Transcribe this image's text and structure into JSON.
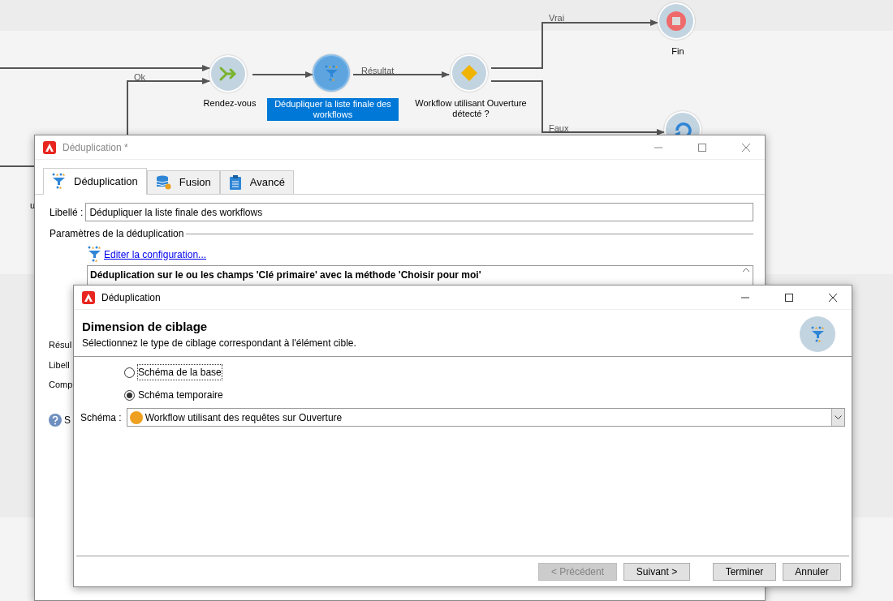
{
  "canvas": {
    "nodes": [
      {
        "kind": "join",
        "label": "Rendez-vous",
        "selected": false
      },
      {
        "kind": "dedup",
        "label": "Dédupliquer la liste finale des workflows",
        "selected": true
      },
      {
        "kind": "test",
        "label": "Workflow utilisant Ouverture détecté ?",
        "selected": false
      },
      {
        "kind": "end",
        "label": "Fin",
        "selected": false
      },
      {
        "kind": "loop",
        "selected": false
      }
    ],
    "edge_labels": [
      "Ok",
      "Résultat",
      "Vrai",
      "Faux"
    ],
    "cut_label": "u"
  },
  "back_window": {
    "title": "Déduplication *",
    "tabs": [
      {
        "kind": "dedup",
        "label": "Déduplication",
        "selected": true
      },
      {
        "kind": "merge",
        "label": "Fusion",
        "selected": false
      },
      {
        "kind": "advanced",
        "label": "Avancé",
        "selected": false
      }
    ],
    "label_field": {
      "label": "Libellé :",
      "value": "Dédupliquer la liste finale des workflows"
    },
    "section_title": "Paramètres de la déduplication",
    "link": "Editer la configuration...",
    "summary": "Déduplication sur le ou les champs 'Clé primaire' avec la méthode 'Choisir pour moi'",
    "cut_labels": [
      "Résul",
      "Libell",
      "Comp"
    ],
    "help_text": "S"
  },
  "front_window": {
    "title": "Déduplication",
    "heading": "Dimension de ciblage",
    "subtitle": "Sélectionnez le type de ciblage correspondant à l'élément cible.",
    "radios": [
      {
        "label": "Schéma de la base",
        "selected": false,
        "focused": true
      },
      {
        "label": "Schéma temporaire",
        "selected": true,
        "focused": false
      }
    ],
    "schema": {
      "label": "Schéma :",
      "value": "Workflow utilisant des requêtes sur Ouverture",
      "color": "#f0a020"
    },
    "buttons": [
      {
        "label": "< Précédent",
        "disabled": true
      },
      {
        "label": "Suivant >",
        "disabled": false
      },
      {
        "label": "Terminer",
        "disabled": false
      },
      {
        "label": "Annuler",
        "disabled": false
      }
    ]
  }
}
